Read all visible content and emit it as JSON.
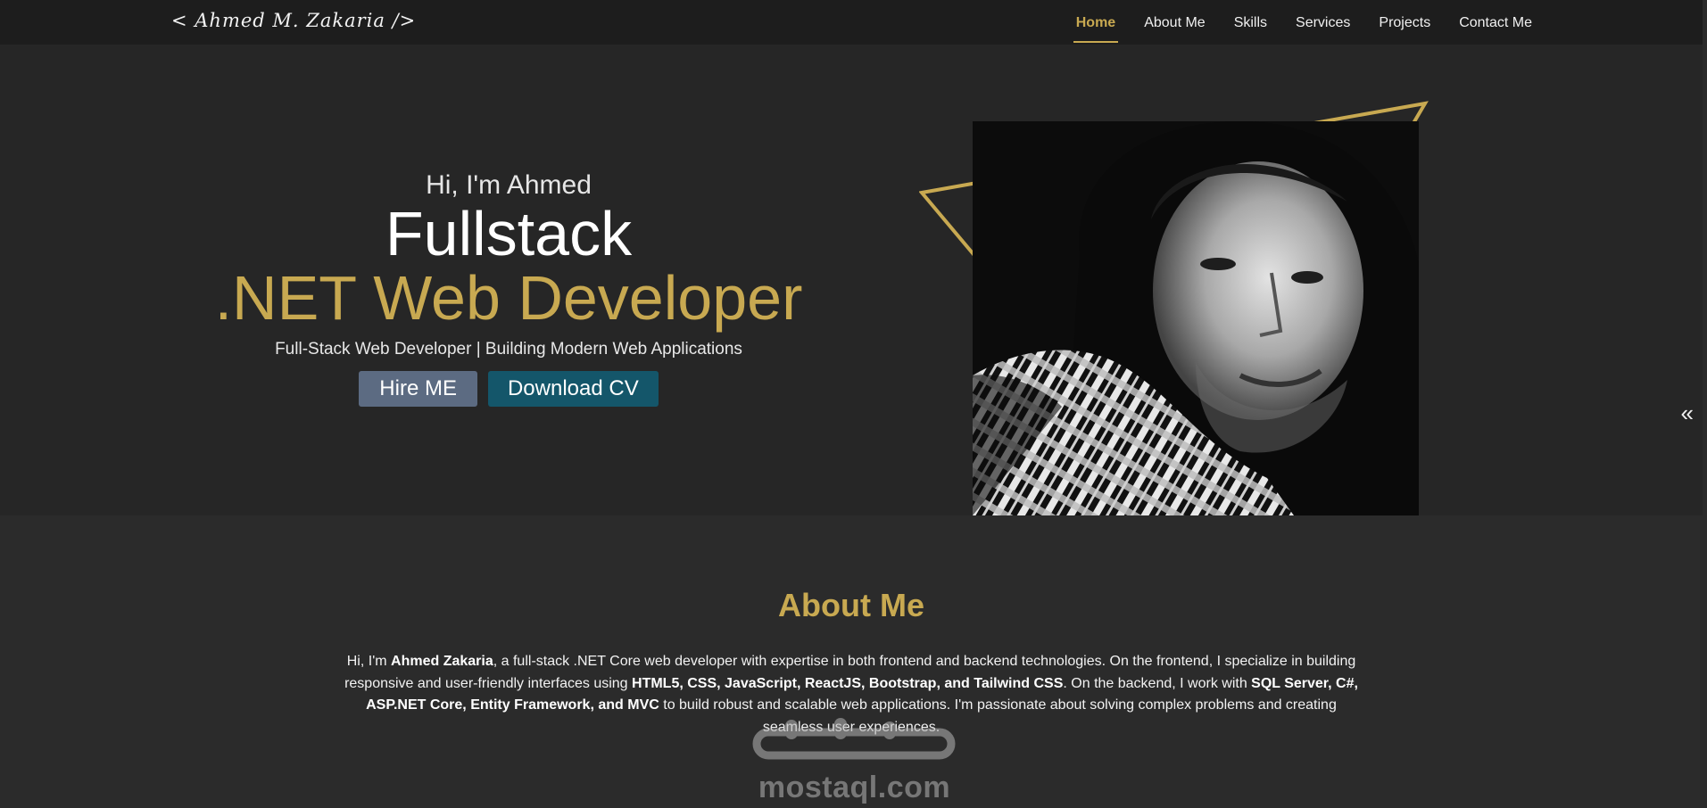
{
  "nav": {
    "brand": "< Ahmed M. Zakaria />",
    "items": [
      {
        "label": "Home",
        "active": true
      },
      {
        "label": "About Me",
        "active": false
      },
      {
        "label": "Skills",
        "active": false
      },
      {
        "label": "Services",
        "active": false
      },
      {
        "label": "Projects",
        "active": false
      },
      {
        "label": "Contact Me",
        "active": false
      }
    ]
  },
  "hero": {
    "greeting": "Hi, I'm Ahmed",
    "title_line1": "Fullstack",
    "title_line2": ".NET Web Developer",
    "tagline": "Full-Stack Web Developer | Building Modern Web Applications",
    "hire_label": "Hire ME",
    "cv_label": "Download CV",
    "side_arrow_icon": "double-chevron-left-icon"
  },
  "about": {
    "heading": "About Me",
    "p1": "Hi, I'm ",
    "name": "Ahmed Zakaria",
    "p2": ", a full-stack .NET Core web developer with expertise in both frontend and backend technologies. On the frontend, I specialize in building responsive and user-friendly interfaces using ",
    "frontend": "HTML5, CSS, JavaScript, ReactJS, Bootstrap, and Tailwind CSS",
    "p3": ". On the backend, I work with ",
    "backend": "SQL Server, C#, ASP.NET Core, Entity Framework, and MVC",
    "p4": " to build robust and scalable web applications. I'm passionate about solving complex problems and creating seamless user experiences."
  },
  "watermark": {
    "arabic": "مستقل",
    "text": "mostaql.com"
  },
  "colors": {
    "accent": "#c8a951",
    "nav_bg": "#1d1d1d",
    "hero_bg": "#262626",
    "page_bg": "#2b2b2b",
    "hire_btn": "#5c6b82",
    "cv_btn": "#14566a"
  }
}
